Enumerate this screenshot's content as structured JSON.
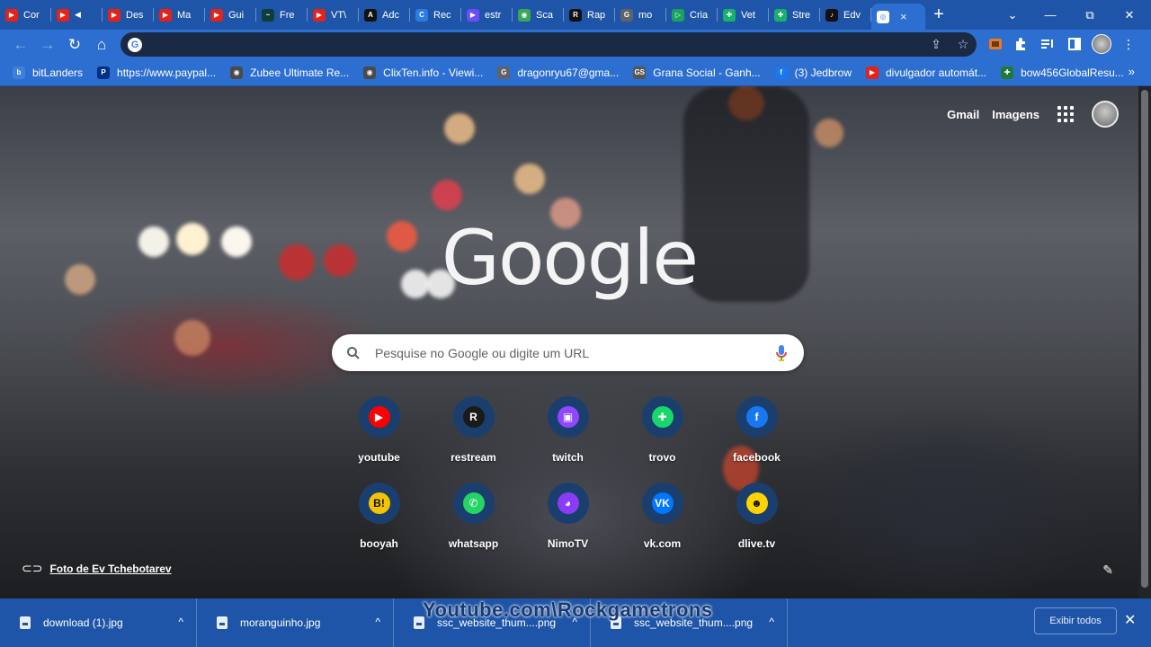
{
  "tabs": [
    {
      "label": "Cor",
      "color": "#e62117",
      "glyph": "▶"
    },
    {
      "label": "",
      "color": "#e62117",
      "glyph": "▶",
      "muted": true
    },
    {
      "label": "Des",
      "color": "#e62117",
      "glyph": "▶"
    },
    {
      "label": "Ma",
      "color": "#e62117",
      "glyph": "▶"
    },
    {
      "label": "Gui",
      "color": "#e62117",
      "glyph": "▶"
    },
    {
      "label": "Fre",
      "color": "#0f3d3a",
      "glyph": "~"
    },
    {
      "label": "VT\\",
      "color": "#e62117",
      "glyph": "▶"
    },
    {
      "label": "Adc",
      "color": "#121212",
      "glyph": "A"
    },
    {
      "label": "Rec",
      "color": "#2a7be4",
      "glyph": "C"
    },
    {
      "label": "estr",
      "color": "#6b4cf6",
      "glyph": "▶"
    },
    {
      "label": "Sca",
      "color": "#3aa757",
      "glyph": "◉"
    },
    {
      "label": "Rap",
      "color": "#111111",
      "glyph": "R"
    },
    {
      "label": "mo",
      "color": "#5f6368",
      "glyph": "G"
    },
    {
      "label": "Cria",
      "color": "#1aa260",
      "glyph": "▷"
    },
    {
      "label": "Vet",
      "color": "#17b26a",
      "glyph": "✚"
    },
    {
      "label": "Stre",
      "color": "#17b26a",
      "glyph": "✚"
    },
    {
      "label": "Edv",
      "color": "#111111",
      "glyph": "♪"
    }
  ],
  "active_tab": {
    "label": "",
    "close": "×"
  },
  "new_tab_label": "+",
  "window_controls": {
    "dropdown": "⌄",
    "minimize": "—",
    "restore": "⧉",
    "close": "✕"
  },
  "nav": {
    "back": "←",
    "forward": "→",
    "reload": "↻",
    "home": "⌂"
  },
  "omnibox": {
    "value": "",
    "share_icon": "⇪",
    "star_icon": "☆"
  },
  "extensions": [
    "fox-extension",
    "puzzle-icon",
    "media-icon",
    "sidepanel-icon",
    "profile-avatar",
    "menu-kebab"
  ],
  "menu_glyph": "⋮",
  "bookmarks": [
    {
      "label": "bitLanders",
      "color": "#3e7fd9",
      "glyph": "b"
    },
    {
      "label": "https://www.paypal...",
      "color": "#003087",
      "glyph": "P"
    },
    {
      "label": "Zubee Ultimate Re...",
      "color": "#4a4a4a",
      "glyph": "◉"
    },
    {
      "label": "ClixTen.info - Viewi...",
      "color": "#4a4a4a",
      "glyph": "◉"
    },
    {
      "label": "dragonryu67@gma...",
      "color": "#5f6368",
      "glyph": "G"
    },
    {
      "label": "Grana Social - Ganh...",
      "color": "#555555",
      "glyph": "GS"
    },
    {
      "label": "(3) Jedbrow",
      "color": "#1877f2",
      "glyph": "f"
    },
    {
      "label": "divulgador automát...",
      "color": "#e62117",
      "glyph": "▶"
    },
    {
      "label": "bow456GlobalResu...",
      "color": "#1d7a3a",
      "glyph": "✚"
    }
  ],
  "bookmarks_more": "»",
  "header_links": {
    "gmail": "Gmail",
    "images": "Imagens"
  },
  "logo_text": "Google",
  "search": {
    "placeholder": "Pesquise no Google ou digite um URL",
    "value": ""
  },
  "shortcuts": [
    {
      "label": "youtube",
      "color": "#ff0000",
      "glyph": "▶"
    },
    {
      "label": "restream",
      "color": "#1a1a1a",
      "glyph": "R"
    },
    {
      "label": "twitch",
      "color": "#9146ff",
      "glyph": "▣"
    },
    {
      "label": "trovo",
      "color": "#19d66b",
      "glyph": "✚"
    },
    {
      "label": "facebook",
      "color": "#1877f2",
      "glyph": "f"
    },
    {
      "label": "booyah",
      "color": "#f5c400",
      "glyph": "B!"
    },
    {
      "label": "whatsapp",
      "color": "#25d366",
      "glyph": "✆"
    },
    {
      "label": "NimoTV",
      "color": "#8a3cf5",
      "glyph": "◕"
    },
    {
      "label": "vk.com",
      "color": "#0077ff",
      "glyph": "VK"
    },
    {
      "label": "dlive.tv",
      "color": "#ffd300",
      "glyph": "☻"
    }
  ],
  "photo_credit": "Foto de Ev Tchebotarev",
  "downloads": [
    {
      "name": "download (1).jpg"
    },
    {
      "name": "moranguinho.jpg"
    },
    {
      "name": "ssc_website_thum....png"
    },
    {
      "name": "ssc_website_thum....png"
    }
  ],
  "download_chevron": "^",
  "show_all_label": "Exibir todos",
  "close_downloads": "✕",
  "watermark": "Youtube.com\\Rockgametrons"
}
